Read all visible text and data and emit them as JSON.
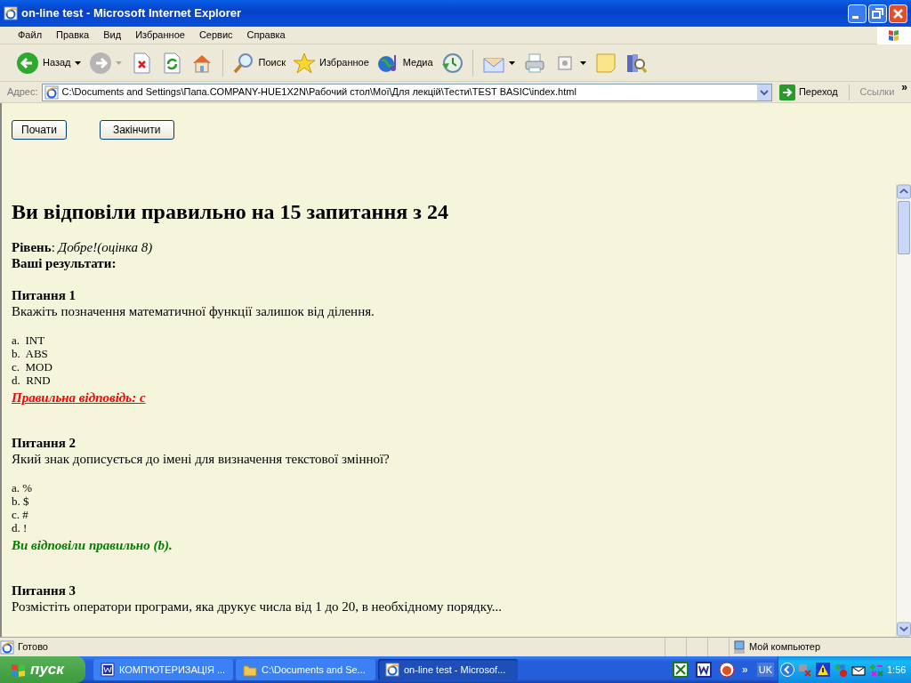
{
  "window": {
    "title": "on-line test - Microsoft Internet Explorer"
  },
  "menu": [
    "Файл",
    "Правка",
    "Вид",
    "Избранное",
    "Сервис",
    "Справка"
  ],
  "toolbar": {
    "back_label": "Назад",
    "forward_disabled": true,
    "search_label": "Поиск",
    "favorites_label": "Избранное",
    "media_label": "Медиа"
  },
  "address_bar": {
    "label": "Адрес:",
    "value": "C:\\Documents and Settings\\Папа.COMPANY-HUE1X2N\\Рабочий стол\\Мої\\Для лекцій\\Тести\\TEST BASIC\\index.html",
    "go_label": "Переход",
    "links_label": "Ссылки",
    "chevron": "»"
  },
  "top_frame": {
    "buttons": [
      "Почати",
      "Закінчити"
    ]
  },
  "results": {
    "heading": "Ви відповіли правильно на 15 запитання з 24",
    "level": "**Рівень**: *Добре!(оцінка 8)*",
    "results_label": "Ваші результати:",
    "questions": [
      {
        "title": "Питання 1",
        "text": "Вкажіть позначення математичної функції залишок від ділення.",
        "options": [
          "a.  INT",
          "b.  ABS",
          "c.  MOD",
          "d.  RND"
        ],
        "feedback": {
          "kind": "wrong",
          "text": "Правильна відповідь: c"
        }
      },
      {
        "title": "Питання 2",
        "text": "Який знак дописується до імені для визначення текстової змінної?",
        "options": [
          "a. %",
          "b. $",
          "c. #",
          "d. !"
        ],
        "feedback": {
          "kind": "right",
          "text": "Ви відповіли правильно (b)."
        }
      },
      {
        "title": "Питання 3",
        "text": "Розмістіть оператори програми, яка друкує числа від 1 до 20, в необхідному порядку..."
      }
    ]
  },
  "status_bar": {
    "text": "Готово",
    "zone": "Мой компьютер"
  },
  "taskbar": {
    "start": "пуск",
    "tasks": [
      {
        "label": "КОМП'ЮТЕРИЗАЦІЯ ...",
        "selected": false
      },
      {
        "label": "C:\\Documents and Se...",
        "selected": false
      },
      {
        "label": "on-line test - Microsof...",
        "selected": true
      }
    ],
    "chevron": "»",
    "language": "UK",
    "clock": "1:56"
  }
}
